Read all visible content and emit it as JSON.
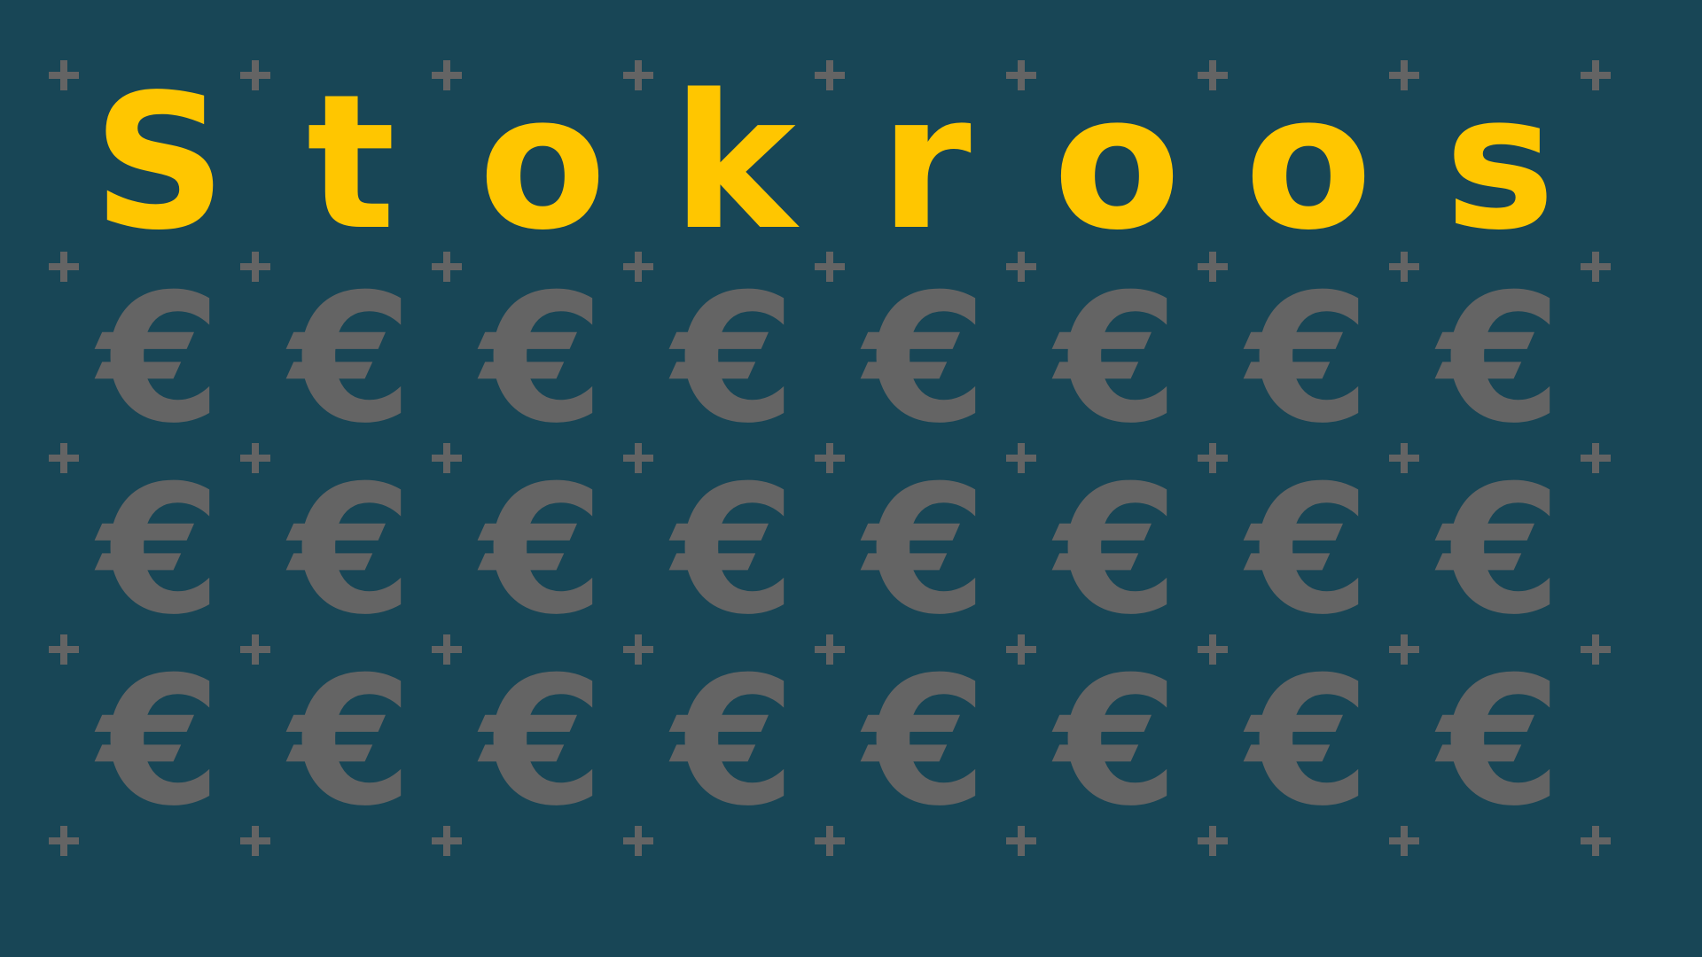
{
  "board": {
    "title_letters": [
      "S",
      "t",
      "o",
      "k",
      "r",
      "o",
      "o",
      "s"
    ],
    "tile_rows": [
      [
        "€",
        "€",
        "€",
        "€",
        "€",
        "€",
        "€",
        "€"
      ],
      [
        "€",
        "€",
        "€",
        "€",
        "€",
        "€",
        "€",
        "€"
      ],
      [
        "€",
        "€",
        "€",
        "€",
        "€",
        "€",
        "€",
        "€"
      ]
    ]
  },
  "colors": {
    "background": "#184656",
    "title": "#FFC600",
    "tiles": "#646464",
    "grid_marks": "#646464"
  },
  "icons": {
    "grid_mark": "plus-icon"
  }
}
